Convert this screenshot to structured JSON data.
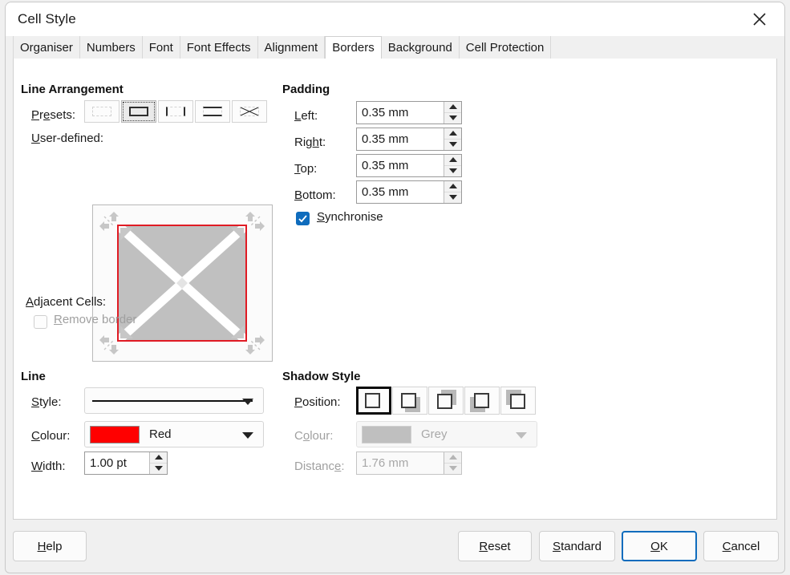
{
  "window": {
    "title": "Cell Style",
    "close_icon": "close-icon"
  },
  "tabs": [
    {
      "label": "Organiser",
      "active": false
    },
    {
      "label": "Numbers",
      "active": false
    },
    {
      "label": "Font",
      "active": false
    },
    {
      "label": "Font Effects",
      "active": false
    },
    {
      "label": "Alignment",
      "active": false
    },
    {
      "label": "Borders",
      "active": true
    },
    {
      "label": "Background",
      "active": false
    },
    {
      "label": "Cell Protection",
      "active": false
    }
  ],
  "line_arrangement": {
    "group_title": "Line Arrangement",
    "presets_label": "Presets:",
    "presets": [
      {
        "name": "no-borders",
        "selected": false
      },
      {
        "name": "box-outline",
        "selected": true
      },
      {
        "name": "left-right-borders",
        "selected": false
      },
      {
        "name": "top-bottom-borders",
        "selected": false
      },
      {
        "name": "box-with-diagonals",
        "selected": false
      }
    ],
    "user_defined_label": "User-defined:",
    "preview": {
      "border_colour": "#e01b24",
      "fill_colour": "#c0c0c0",
      "diagonal_colour": "#ffffff",
      "marker_colour": "#c7c7c7"
    }
  },
  "padding": {
    "group_title": "Padding",
    "fields": [
      {
        "label": "Left:",
        "value": "0.35 mm"
      },
      {
        "label": "Right:",
        "value": "0.35 mm"
      },
      {
        "label": "Top:",
        "value": "0.35 mm"
      },
      {
        "label": "Bottom:",
        "value": "0.35 mm"
      }
    ],
    "synchronise_label": "Synchronise",
    "synchronise_checked": true
  },
  "adjacent_cells": {
    "label": "Adjacent Cells:",
    "remove_border_label": "Remove border",
    "remove_border_checked": false,
    "enabled": false
  },
  "line": {
    "group_title": "Line",
    "style_label": "Style:",
    "style_value": "solid",
    "colour_label": "Colour:",
    "colour_value": "Red",
    "colour_hex": "#ff0000",
    "width_label": "Width:",
    "width_value": "1.00 pt"
  },
  "shadow_style": {
    "group_title": "Shadow Style",
    "position_label": "Position:",
    "positions": [
      {
        "name": "no-shadow",
        "selected": true
      },
      {
        "name": "shadow-bottom-right",
        "selected": false
      },
      {
        "name": "shadow-top-right",
        "selected": false
      },
      {
        "name": "shadow-bottom-left",
        "selected": false
      },
      {
        "name": "shadow-top-left",
        "selected": false
      }
    ],
    "colour_label": "Colour:",
    "colour_value": "Grey",
    "colour_hex": "#bfbfbf",
    "distance_label": "Distance:",
    "distance_value": "1.76 mm",
    "enabled": false
  },
  "footer": {
    "help": "Help",
    "reset": "Reset",
    "standard": "Standard",
    "ok": "OK",
    "cancel": "Cancel",
    "default_button": "OK"
  }
}
